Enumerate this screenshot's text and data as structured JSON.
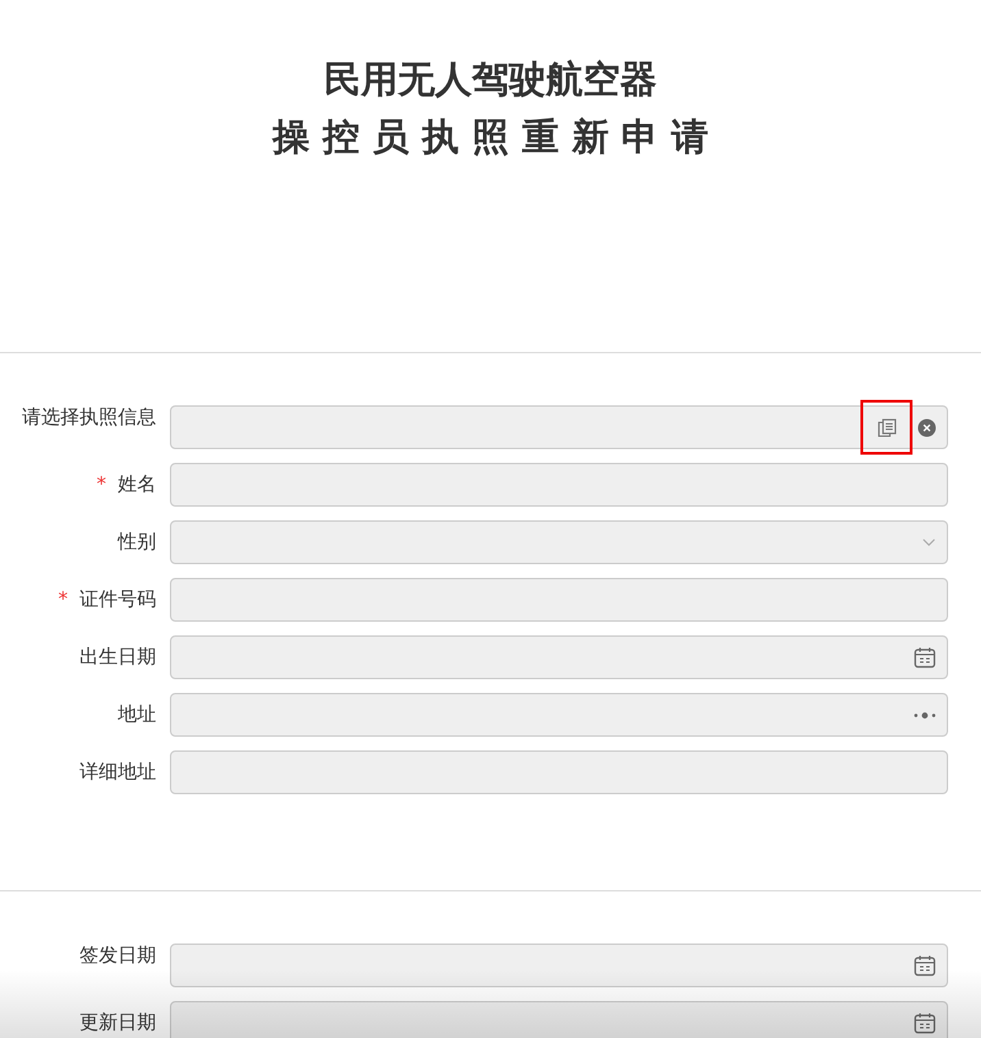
{
  "title": {
    "line1": "民用无人驾驶航空器",
    "line2": "操 控 员 执 照 重 新 申 请"
  },
  "sections": [
    {
      "fields": [
        {
          "label": "请选择执照信息",
          "required": false,
          "kind": "picker",
          "highlighted": true
        },
        {
          "label": "姓名",
          "required": true,
          "kind": "text"
        },
        {
          "label": "性别",
          "required": false,
          "kind": "select"
        },
        {
          "label": "证件号码",
          "required": true,
          "kind": "text"
        },
        {
          "label": "出生日期",
          "required": false,
          "kind": "date"
        },
        {
          "label": "地址",
          "required": false,
          "kind": "address"
        },
        {
          "label": "详细地址",
          "required": false,
          "kind": "text"
        }
      ]
    },
    {
      "fields": [
        {
          "label": "签发日期",
          "required": false,
          "kind": "date"
        },
        {
          "label": "更新日期",
          "required": false,
          "kind": "date"
        }
      ]
    }
  ],
  "required_mark": "*"
}
